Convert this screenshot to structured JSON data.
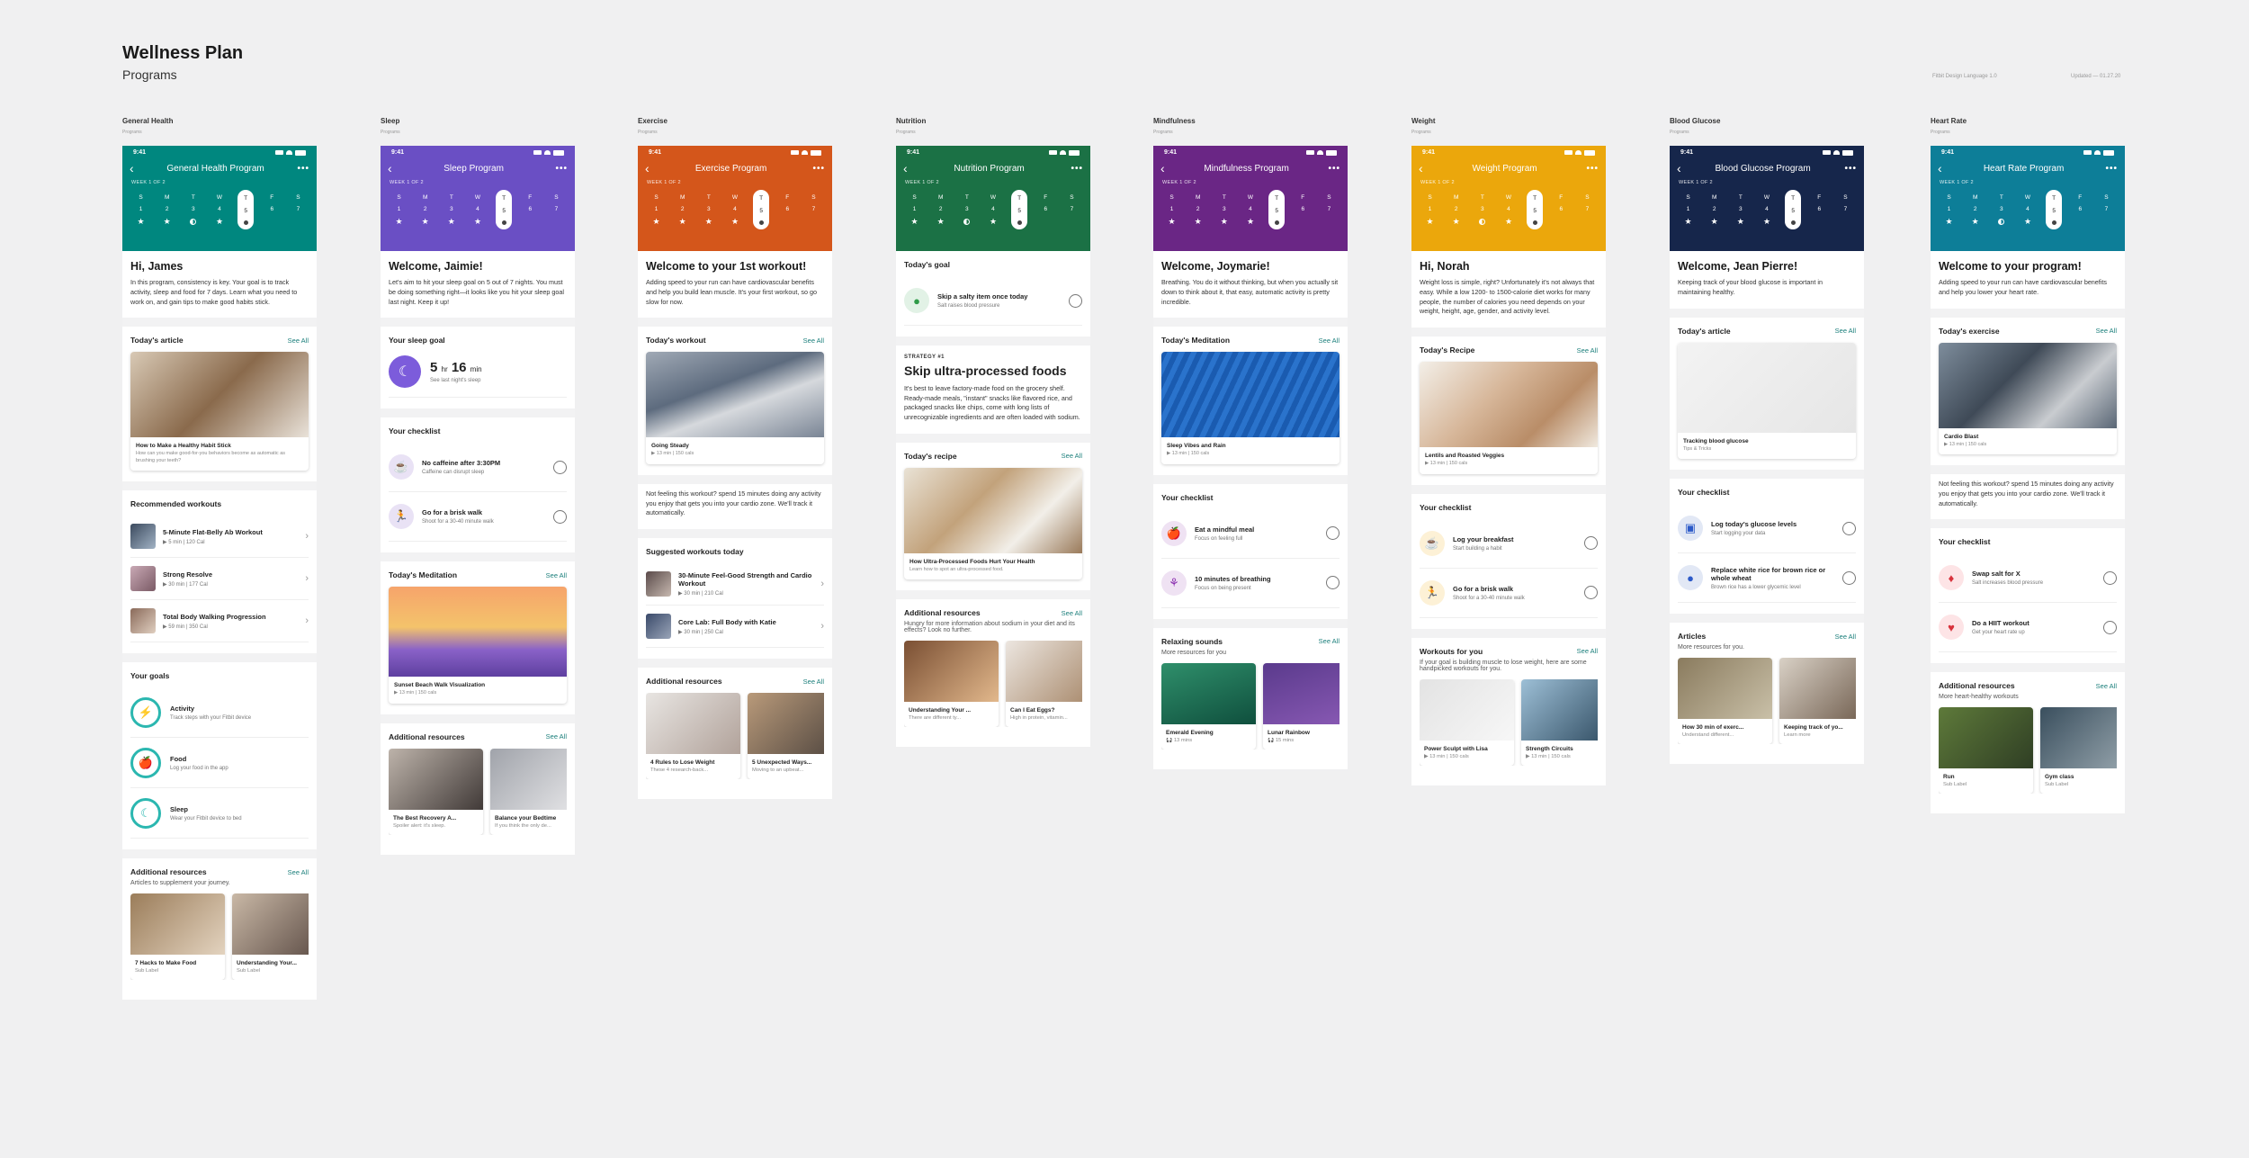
{
  "page": {
    "title": "Wellness Plan",
    "subtitle": "Programs",
    "meta_left": "Fitbit Design Language 1.0",
    "meta_right": "Updated — 01.27.20"
  },
  "status": {
    "time": "9:41"
  },
  "week_label": "WEEK 1 OF 2",
  "day_letters": [
    "S",
    "M",
    "T",
    "W",
    "T",
    "F",
    "S"
  ],
  "day_nums": [
    "1",
    "2",
    "3",
    "4",
    "5",
    "6",
    "7"
  ],
  "common": {
    "see_all": "See All"
  },
  "columns": [
    {
      "label": "General Health",
      "sublabel": "Programs",
      "color": "#00877f",
      "program": "General Health Program",
      "marks": [
        "star",
        "star",
        "half",
        "star",
        "dot",
        "",
        ""
      ],
      "greeting": "Hi, James",
      "intro": "In this program, consistency is key. Your goal is to track activity, sleep and food for 7 days. Learn what you need to work on, and gain tips to make good habits stick.",
      "article": {
        "header": "Today's article",
        "title": "How to Make a Healthy Habit Stick",
        "sub": "How can you make good-for-you behaviors become as automatic as brushing your teeth?"
      },
      "workouts": {
        "header": "Recommended workouts",
        "items": [
          {
            "t": "5-Minute Flat-Belly Ab Workout",
            "s": "▶  5 min  |  120 Cal"
          },
          {
            "t": "Strong Resolve",
            "s": "▶  30 min  |  177 Cal"
          },
          {
            "t": "Total Body Walking Progression",
            "s": "▶  59 min  |  350 Cal"
          }
        ]
      },
      "goals": {
        "header": "Your goals",
        "items": [
          {
            "t": "Activity",
            "s": "Track steps with your Fitbit device"
          },
          {
            "t": "Food",
            "s": "Log your food in the app"
          },
          {
            "t": "Sleep",
            "s": "Wear your Fitbit device to bed"
          }
        ]
      },
      "resources": {
        "header": "Additional resources",
        "sub": "Articles to supplement your journey.",
        "items": [
          {
            "t": "7 Hacks to Make Food",
            "s": "Sub Label"
          },
          {
            "t": "Understanding Your...",
            "s": "Sub Label"
          }
        ]
      }
    },
    {
      "label": "Sleep",
      "sublabel": "Programs",
      "color": "#6a4fc4",
      "program": "Sleep Program",
      "marks": [
        "star",
        "star",
        "star",
        "star",
        "dot",
        "",
        ""
      ],
      "greeting": "Welcome, Jaimie!",
      "intro": "Let's aim to hit your sleep goal on 5 out of 7 nights. You must be doing something right—it looks like you hit your sleep goal last night. Keep it up!",
      "sleepgoal": {
        "header": "Your sleep goal",
        "h": "5",
        "hr": "hr",
        "m": "16",
        "min": "min",
        "sub": "See last night's sleep"
      },
      "checklist": {
        "header": "Your checklist",
        "items": [
          {
            "t": "No caffeine after 3:30PM",
            "s": "Caffeine can disrupt sleep"
          },
          {
            "t": "Go for a brisk walk",
            "s": "Shoot for a 30-40 minute walk"
          }
        ]
      },
      "meditation": {
        "header": "Today's Meditation",
        "title": "Sunset Beach Walk Visualization",
        "sub": "▶  13 min  |  150 cals"
      },
      "resources": {
        "header": "Additional resources",
        "items": [
          {
            "t": "The Best Recovery A...",
            "s": "Spoiler alert: it's sleep."
          },
          {
            "t": "Balance your Bedtime",
            "s": "If you think the only de..."
          }
        ]
      }
    },
    {
      "label": "Exercise",
      "sublabel": "Programs",
      "color": "#d4561b",
      "program": "Exercise Program",
      "marks": [
        "star",
        "star",
        "star",
        "star",
        "dot",
        "",
        ""
      ],
      "greeting": "Welcome to your 1st workout!",
      "intro": "Adding speed to your run can have cardiovascular benefits and help you build lean muscle. It's your first workout, so go slow for now.",
      "workout": {
        "header": "Today's workout",
        "title": "Going Steady",
        "sub": "▶  13 min  |  150 cals"
      },
      "note": "Not feeling this workout? spend 15 minutes doing any activity you enjoy that gets you into your cardio zone. We'll track it automatically.",
      "suggested": {
        "header": "Suggested workouts today",
        "items": [
          {
            "t": "30-Minute Feel-Good Strength and Cardio Workout",
            "s": "▶  30 min  |  210 Cal"
          },
          {
            "t": "Core Lab: Full Body with Katie",
            "s": "▶  30 min  |  250 Cal"
          }
        ]
      },
      "resources": {
        "header": "Additional resources",
        "items": [
          {
            "t": "4 Rules to Lose Weight",
            "s": "These 4 research-back..."
          },
          {
            "t": "5 Unexpected Ways...",
            "s": "Moving to an upbeat..."
          }
        ]
      }
    },
    {
      "label": "Nutrition",
      "sublabel": "Programs",
      "color": "#1b7145",
      "program": "Nutrition Program",
      "marks": [
        "star",
        "star",
        "half",
        "star",
        "dot",
        "",
        ""
      ],
      "goal": {
        "header": "Today's goal",
        "t": "Skip a salty item once today",
        "s": "Salt raises blood pressure"
      },
      "strategy": {
        "label": "STRATEGY #1",
        "title": "Skip ultra-processed foods",
        "body": "It's best to leave factory-made food on the grocery shelf. Ready-made meals, \"instant\" snacks like flavored rice, and packaged snacks like chips, come with long lists of unrecognizable ingredients and are often loaded with sodium."
      },
      "recipe": {
        "header": "Today's recipe",
        "title": "How Ultra-Processed Foods Hurt Your Health",
        "sub": "Learn how to spot an ultra-processed food."
      },
      "resources": {
        "header": "Additional resources",
        "sub": "Hungry for more information about sodium in your diet and its effects? Look no further.",
        "items": [
          {
            "t": "Understanding Your ...",
            "s": "There are different ty..."
          },
          {
            "t": "Can I Eat Eggs?",
            "s": "High in protein, vitamin..."
          }
        ]
      }
    },
    {
      "label": "Mindfulness",
      "sublabel": "Programs",
      "color": "#6a2685",
      "program": "Mindfulness Program",
      "marks": [
        "star",
        "star",
        "star",
        "star",
        "dot",
        "",
        ""
      ],
      "greeting": "Welcome, Joymarie!",
      "intro": "Breathing. You do it without thinking, but when you actually sit down to think about it, that easy, automatic activity is pretty incredible.",
      "meditation": {
        "header": "Today's Meditation",
        "title": "Sleep Vibes and Rain",
        "sub": "▶  13 min  |  150 cals"
      },
      "checklist": {
        "header": "Your checklist",
        "items": [
          {
            "t": "Eat a mindful meal",
            "s": "Focus on feeling full"
          },
          {
            "t": "10 minutes of breathing",
            "s": "Focus on being present"
          }
        ]
      },
      "sounds": {
        "header": "Relaxing sounds",
        "sub": "More resources for you",
        "items": [
          {
            "t": "Emerald Evening",
            "s": "🎧 13 mins"
          },
          {
            "t": "Lunar Rainbow",
            "s": "🎧 15 mins"
          }
        ]
      }
    },
    {
      "label": "Weight",
      "sublabel": "Programs",
      "color": "#eba70c",
      "program": "Weight Program",
      "marks": [
        "star",
        "star",
        "half",
        "star",
        "dot",
        "",
        ""
      ],
      "greeting": "Hi, Norah",
      "intro": "Weight loss is simple, right? Unfortunately it's not always that easy. While a low 1200- to 1500-calorie diet works for many people, the number of calories you need depends on your weight, height, age, gender, and activity level.",
      "recipe": {
        "header": "Today's Recipe",
        "title": "Lentils and Roasted Veggies",
        "sub": "▶  13 min  |  150 cals"
      },
      "checklist": {
        "header": "Your checklist",
        "items": [
          {
            "t": "Log your breakfast",
            "s": "Start building a habit"
          },
          {
            "t": "Go for a brisk walk",
            "s": "Shoot for a 30-40 minute walk"
          }
        ]
      },
      "workouts": {
        "header": "Workouts for you",
        "sub": "If your goal is building muscle to lose weight, here are some handpicked workouts for you.",
        "items": [
          {
            "t": "Power Sculpt with Lisa",
            "s": "▶  13 min  |  150 cals"
          },
          {
            "t": "Strength Circuits",
            "s": "▶  13 min  |  150 cals"
          }
        ]
      }
    },
    {
      "label": "Blood Glucose",
      "sublabel": "Programs",
      "color": "#16264b",
      "program": "Blood Glucose Program",
      "marks": [
        "star",
        "star",
        "star",
        "star",
        "dot",
        "",
        ""
      ],
      "greeting": "Welcome, Jean Pierre!",
      "intro": "Keeping track of your blood glucose is important in maintaining healthy.",
      "article": {
        "header": "Today's article",
        "title": "Tracking blood glucose",
        "sub": "Tips & Tricks"
      },
      "checklist": {
        "header": "Your checklist",
        "items": [
          {
            "t": "Log today's glucose levels",
            "s": "Start logging your data"
          },
          {
            "t": "Replace white rice for brown rice or whole wheat",
            "s": "Brown rice has a lower glycemic level"
          }
        ]
      },
      "articles": {
        "header": "Articles",
        "sub": "More resources for you.",
        "items": [
          {
            "t": "How 30 min of exerc...",
            "s": "Understand different..."
          },
          {
            "t": "Keeping track of yo...",
            "s": "Learn more"
          }
        ]
      }
    },
    {
      "label": "Heart Rate",
      "sublabel": "Programs",
      "color": "#0d7e98",
      "program": "Heart Rate Program",
      "marks": [
        "star",
        "star",
        "half",
        "star",
        "dot",
        "",
        ""
      ],
      "greeting": "Welcome to your program!",
      "intro": "Adding speed to your run can have cardiovascular benefits and help you lower your heart rate.",
      "exercise": {
        "header": "Today's exercise",
        "title": "Cardio Blast",
        "sub": "▶  13 min  |  150 cals"
      },
      "note": "Not feeling this workout? spend 15 minutes doing any activity you enjoy that gets you into your cardio zone. We'll track it automatically.",
      "checklist": {
        "header": "Your checklist",
        "items": [
          {
            "t": "Swap salt for X",
            "s": "Salt increases blood pressure"
          },
          {
            "t": "Do a HIIT workout",
            "s": "Get your heart rate up"
          }
        ]
      },
      "resources": {
        "header": "Additional resources",
        "sub": "More heart-healthy workouts",
        "items": [
          {
            "t": "Run",
            "s": "Sub Label"
          },
          {
            "t": "Gym class",
            "s": "Sub Label"
          }
        ]
      }
    }
  ]
}
